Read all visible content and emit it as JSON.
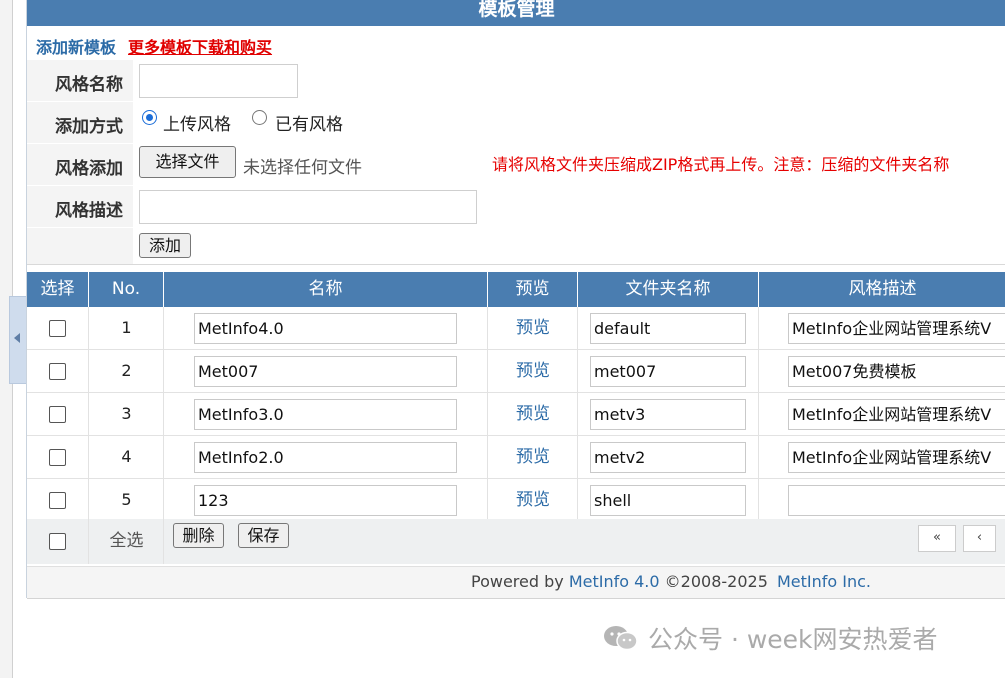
{
  "header": {
    "title": "模板管理"
  },
  "links": {
    "add_template": "添加新模板",
    "more_templates": "更多模板下载和购买"
  },
  "form": {
    "style_name_label": "风格名称",
    "add_method_label": "添加方式",
    "radio_upload": "上传风格",
    "radio_existing": "已有风格",
    "style_add_label": "风格添加",
    "choose_file_button": "选择文件",
    "no_file_text": "未选择任何文件",
    "hint": "请将风格文件夹压缩成ZIP格式再上传。注意：压缩的文件夹名称",
    "style_desc_label": "风格描述",
    "add_button": "添加"
  },
  "table": {
    "columns": [
      "选择",
      "No.",
      "名称",
      "预览",
      "文件夹名称",
      "风格描述"
    ],
    "preview_label": "预览",
    "rows": [
      {
        "no": "1",
        "name": "MetInfo4.0",
        "folder": "default",
        "desc": "MetInfo企业网站管理系统V"
      },
      {
        "no": "2",
        "name": "Met007",
        "folder": "met007",
        "desc": "Met007免费模板"
      },
      {
        "no": "3",
        "name": "MetInfo3.0",
        "folder": "metv3",
        "desc": "MetInfo企业网站管理系统V"
      },
      {
        "no": "4",
        "name": "MetInfo2.0",
        "folder": "metv2",
        "desc": "MetInfo企业网站管理系统V"
      },
      {
        "no": "5",
        "name": "123",
        "folder": "shell",
        "desc": ""
      }
    ],
    "select_all": "全选",
    "delete_button": "删除",
    "save_button": "保存",
    "first_page": "«",
    "prev_page": "‹"
  },
  "footer": {
    "powered_by": "Powered by",
    "product": "MetInfo 4.0",
    "copyright": "©2008-2025",
    "company": "MetInfo Inc."
  },
  "watermark": {
    "text": "公众号 · week网安热爱者"
  }
}
